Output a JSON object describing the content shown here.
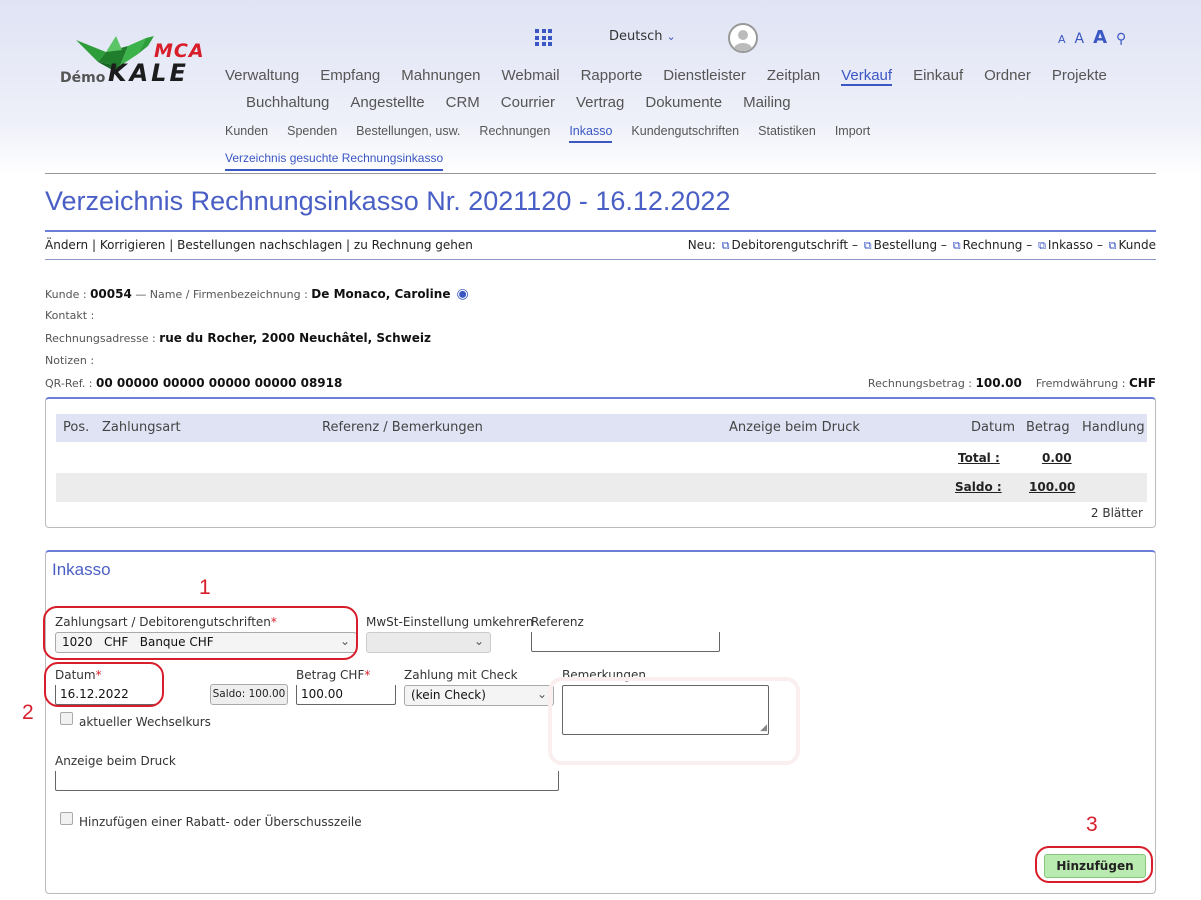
{
  "logo": {
    "brand_top": "MCA",
    "brand_prefix": "Démo",
    "brand_main": "KALE"
  },
  "topbar": {
    "language": "Deutsch",
    "font_sizes": [
      "A",
      "A",
      "A"
    ]
  },
  "nav": {
    "main_row1": [
      "Verwaltung",
      "Empfang",
      "Mahnungen",
      "Webmail",
      "Rapporte",
      "Dienstleister",
      "Zeitplan",
      "Verkauf",
      "Einkauf",
      "Ordner",
      "Projekte"
    ],
    "main_row2": [
      "Buchhaltung",
      "Angestellte",
      "CRM",
      "Courrier",
      "Vertrag",
      "Dokumente",
      "Mailing"
    ],
    "active_main": "Verkauf",
    "sub": [
      "Kunden",
      "Spenden",
      "Bestellungen, usw.",
      "Rechnungen",
      "Inkasso",
      "Kundengutschriften",
      "Statistiken",
      "Import"
    ],
    "active_sub": "Inkasso",
    "subsub": "Verzeichnis gesuchte Rechnungsinkasso"
  },
  "page": {
    "title": "Verzeichnis Rechnungsinkasso Nr. 2021120 - 16.12.2022",
    "actions": "Ändern | Korrigieren | Bestellungen nachschlagen | zu Rechnung gehen",
    "new_label": "Neu:",
    "new_links": [
      "Debitorengutschrift",
      "Bestellung",
      "Rechnung",
      "Inkasso",
      "Kunde"
    ]
  },
  "info": {
    "kunde_label": "Kunde :",
    "kunde_value": "00054",
    "name_label": "— Name / Firmenbezeichnung :",
    "name_value": "De Monaco, Caroline",
    "kontakt_label": "Kontakt :",
    "adresse_label": "Rechnungsadresse :",
    "adresse_value": "rue du Rocher, 2000 Neuchâtel, Schweiz",
    "notizen_label": "Notizen :",
    "qr_label": "QR-Ref. :",
    "qr_value": "00 00000 00000 00000 00000 08918",
    "betrag_label": "Rechnungsbetrag :",
    "betrag_value": "100.00",
    "waehrung_label": "Fremdwährung :",
    "waehrung_value": "CHF"
  },
  "table": {
    "headers": [
      "Pos.",
      "Zahlungsart",
      "Referenz / Bemerkungen",
      "Anzeige beim Druck",
      "Datum",
      "Betrag",
      "Handlung"
    ],
    "total_label": "Total :",
    "total_value": "0.00",
    "saldo_label": "Saldo :",
    "saldo_value": "100.00",
    "sheets": "2 Blätter"
  },
  "form": {
    "title": "Inkasso",
    "zahlungsart_label": "Zahlungsart / Debitorengutschriften",
    "zahlungsart_value": "1020   CHF   Banque CHF",
    "mwst_label": "MwSt-Einstellung umkehren",
    "referenz_label": "Referenz",
    "datum_label": "Datum",
    "datum_value": "16.12.2022",
    "saldo_button": "Saldo: 100.00",
    "betrag_label": "Betrag CHF",
    "betrag_value": "100.00",
    "check_label": "Zahlung mit Check",
    "check_value": "(kein Check)",
    "bemerkungen_label": "Bemerkungen",
    "wechselkurs_label": "aktueller Wechselkurs",
    "anzeige_label": "Anzeige beim Druck",
    "rabatt_label": "Hinzufügen einer Rabatt- oder Überschusszeile",
    "add_button": "Hinzufügen",
    "required_mark": "*"
  },
  "annotations": {
    "n1": "1",
    "n2": "2",
    "n3": "3"
  },
  "colors": {
    "accent": "#3b57c4",
    "title": "#4a5fc5",
    "annotation": "#d81e2a",
    "add_button": "#b9eab0"
  }
}
